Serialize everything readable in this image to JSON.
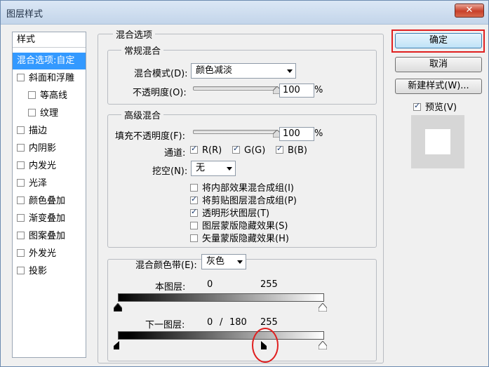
{
  "window": {
    "title": "图层样式",
    "close_glyph": "✕"
  },
  "sidebar": {
    "header": "样式",
    "items": [
      {
        "label": "混合选项:自定",
        "selected": true,
        "checkbox": false
      },
      {
        "label": "斜面和浮雕",
        "checkbox": true,
        "checked": false,
        "indent": false
      },
      {
        "label": "等高线",
        "checkbox": true,
        "checked": false,
        "indent": true
      },
      {
        "label": "纹理",
        "checkbox": true,
        "checked": false,
        "indent": true
      },
      {
        "label": "描边",
        "checkbox": true,
        "checked": false
      },
      {
        "label": "内阴影",
        "checkbox": true,
        "checked": false
      },
      {
        "label": "内发光",
        "checkbox": true,
        "checked": false
      },
      {
        "label": "光泽",
        "checkbox": true,
        "checked": false
      },
      {
        "label": "颜色叠加",
        "checkbox": true,
        "checked": false
      },
      {
        "label": "渐变叠加",
        "checkbox": true,
        "checked": false
      },
      {
        "label": "图案叠加",
        "checkbox": true,
        "checked": false
      },
      {
        "label": "外发光",
        "checkbox": true,
        "checked": false
      },
      {
        "label": "投影",
        "checkbox": true,
        "checked": false
      }
    ]
  },
  "blending": {
    "title": "混合选项",
    "general": {
      "title": "常规混合",
      "mode_label": "混合模式(D):",
      "mode_value": "颜色减淡",
      "opacity_label": "不透明度(O):",
      "opacity_value": "100",
      "opacity_unit": "%",
      "opacity_fraction": 1.0
    },
    "advanced": {
      "title": "高级混合",
      "fill_label": "填充不透明度(F):",
      "fill_value": "100",
      "fill_unit": "%",
      "fill_fraction": 1.0,
      "channels_label": "通道:",
      "channel_r": "R(R)",
      "channel_g": "G(G)",
      "channel_b": "B(B)",
      "knockout_label": "挖空(N):",
      "knockout_value": "无",
      "options": [
        {
          "label": "将内部效果混合成组(I)",
          "checked": false
        },
        {
          "label": "将剪贴图层混合成组(P)",
          "checked": true
        },
        {
          "label": "透明形状图层(T)",
          "checked": true
        },
        {
          "label": "图层蒙版隐藏效果(S)",
          "checked": false
        },
        {
          "label": "矢量蒙版隐藏效果(H)",
          "checked": false
        }
      ]
    },
    "blend_if": {
      "label": "混合颜色带(E):",
      "value": "灰色",
      "this_layer_label": "本图层:",
      "this_layer_low": "0",
      "this_layer_high": "255",
      "underlying_label": "下一图层:",
      "underlying_low": "0",
      "underlying_sep": "/",
      "underlying_split": "180",
      "underlying_high": "255"
    }
  },
  "buttons": {
    "ok": "确定",
    "cancel": "取消",
    "new_style": "新建样式(W)...",
    "preview_label": "预览(V)",
    "preview_checked": true
  },
  "colors": {
    "selected": "#3399ff",
    "highlight": "#e02020"
  }
}
